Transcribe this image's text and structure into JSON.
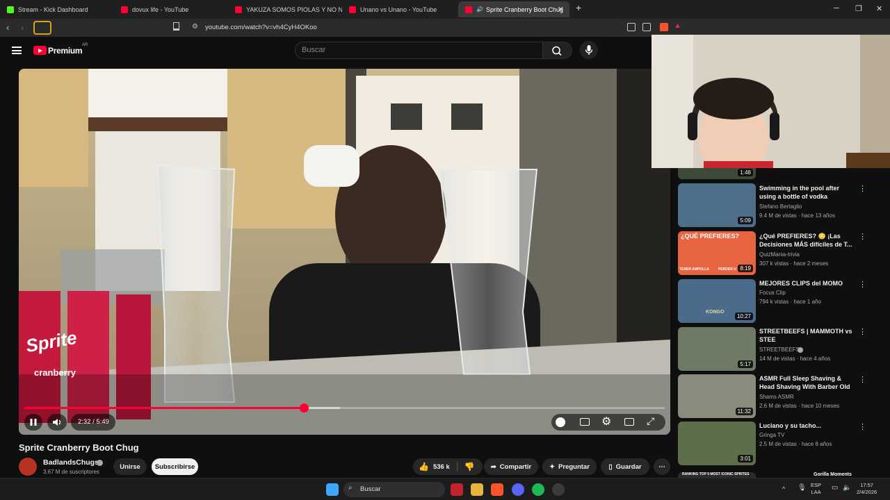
{
  "browser": {
    "tabs": [
      {
        "label": "Stream - Kick Dashboard",
        "favicon_color": "#53fc18",
        "active": false
      },
      {
        "label": "dovux life - YouTube",
        "favicon_color": "#ff0033",
        "active": false
      },
      {
        "label": "YAKUZA SOMOS PIOLAS Y NO NOS",
        "favicon_color": "#ff0033",
        "active": false
      },
      {
        "label": "Unano vs Unano - YouTube",
        "favicon_color": "#ff0033",
        "active": false
      },
      {
        "label": "Sprite Cranberry Boot Chug",
        "favicon_color": "#ff0033",
        "active": true
      }
    ],
    "url": "youtube.com/watch?v=vh4CyH4OKoo"
  },
  "youtube": {
    "logo_text": "Premium",
    "country_code": "AR",
    "search_placeholder": "Buscar"
  },
  "player": {
    "current_time": "2:32",
    "duration": "5:49",
    "time_display": "2:32 / 5:49",
    "progress_fraction": 0.436,
    "buffered_fraction": 0.493,
    "state": "playing",
    "scene_text": {
      "can_brand": "Sprite",
      "can_flavor": "cranberry"
    }
  },
  "video": {
    "title": "Sprite Cranberry Boot Chug",
    "channel_name": "BadlandsChugs",
    "channel_verified": true,
    "subscribers": "3.67 M de suscriptores",
    "join_label": "Unirse",
    "subscribe_label": "Subscribirse",
    "likes": "536 k",
    "share_label": "Compartir",
    "ask_label": "Preguntar",
    "save_label": "Guardar"
  },
  "recommendations": [
    {
      "title": "",
      "channel": "",
      "meta": "",
      "duration": "1:48"
    },
    {
      "title": "Swimming in the pool after using a bottle of vodka",
      "channel": "Stefano Bertaglio",
      "meta": "9.4 M de vistas · hace 13 años",
      "duration": "5:09"
    },
    {
      "title": "¿Qué PREFIERES? 😳 ¡Las Decisiones MÁS difíciles de T...",
      "channel": "QuizMania-trivia",
      "meta": "307 k vistas · hace 2 meses",
      "duration": "8:19",
      "thumb_text": "¿QUÉ PREFIERES?",
      "thumb_sub_left": "TENER AMPOLLA",
      "thumb_sub_right": "PERDER U"
    },
    {
      "title": "MEJORES CLIPS del MOMO",
      "channel": "Focus Clip",
      "meta": "794 k vistas · hace 1 año",
      "duration": "10:27",
      "thumb_text": "KONGO"
    },
    {
      "title": "STREETBEEFS | MAMMOTH vs STEE",
      "channel": "STREETBEEFS",
      "channel_verified": true,
      "meta": "14 M de vistas · hace 4 años",
      "duration": "5:17"
    },
    {
      "title": "ASMR Full Sleep Shaving & Head Shaving With Barber Old ...",
      "channel": "Shams ASMR",
      "meta": "2.6 M de vistas · hace 10 meses",
      "duration": "11:32"
    },
    {
      "title": "Luciano y su tacho...",
      "channel": "Gringa TV",
      "meta": "2.5 M de vistas · hace 8 años",
      "duration": "3:01"
    },
    {
      "title": "",
      "channel": "",
      "meta": "",
      "duration": "",
      "thumb_text": "RANKING TOP 5 MOST ICONIC SPRITES",
      "thumb_text_right": "Gorilla Moments"
    }
  ],
  "taskbar": {
    "search_label": "Buscar",
    "lang_top": "ESP",
    "lang_bottom": "LAA",
    "time": "17:57",
    "date": "2/4/2026"
  },
  "colors": {
    "youtube_red": "#ff0033",
    "background": "#0f0f0f",
    "kick_green": "#53fc18"
  }
}
